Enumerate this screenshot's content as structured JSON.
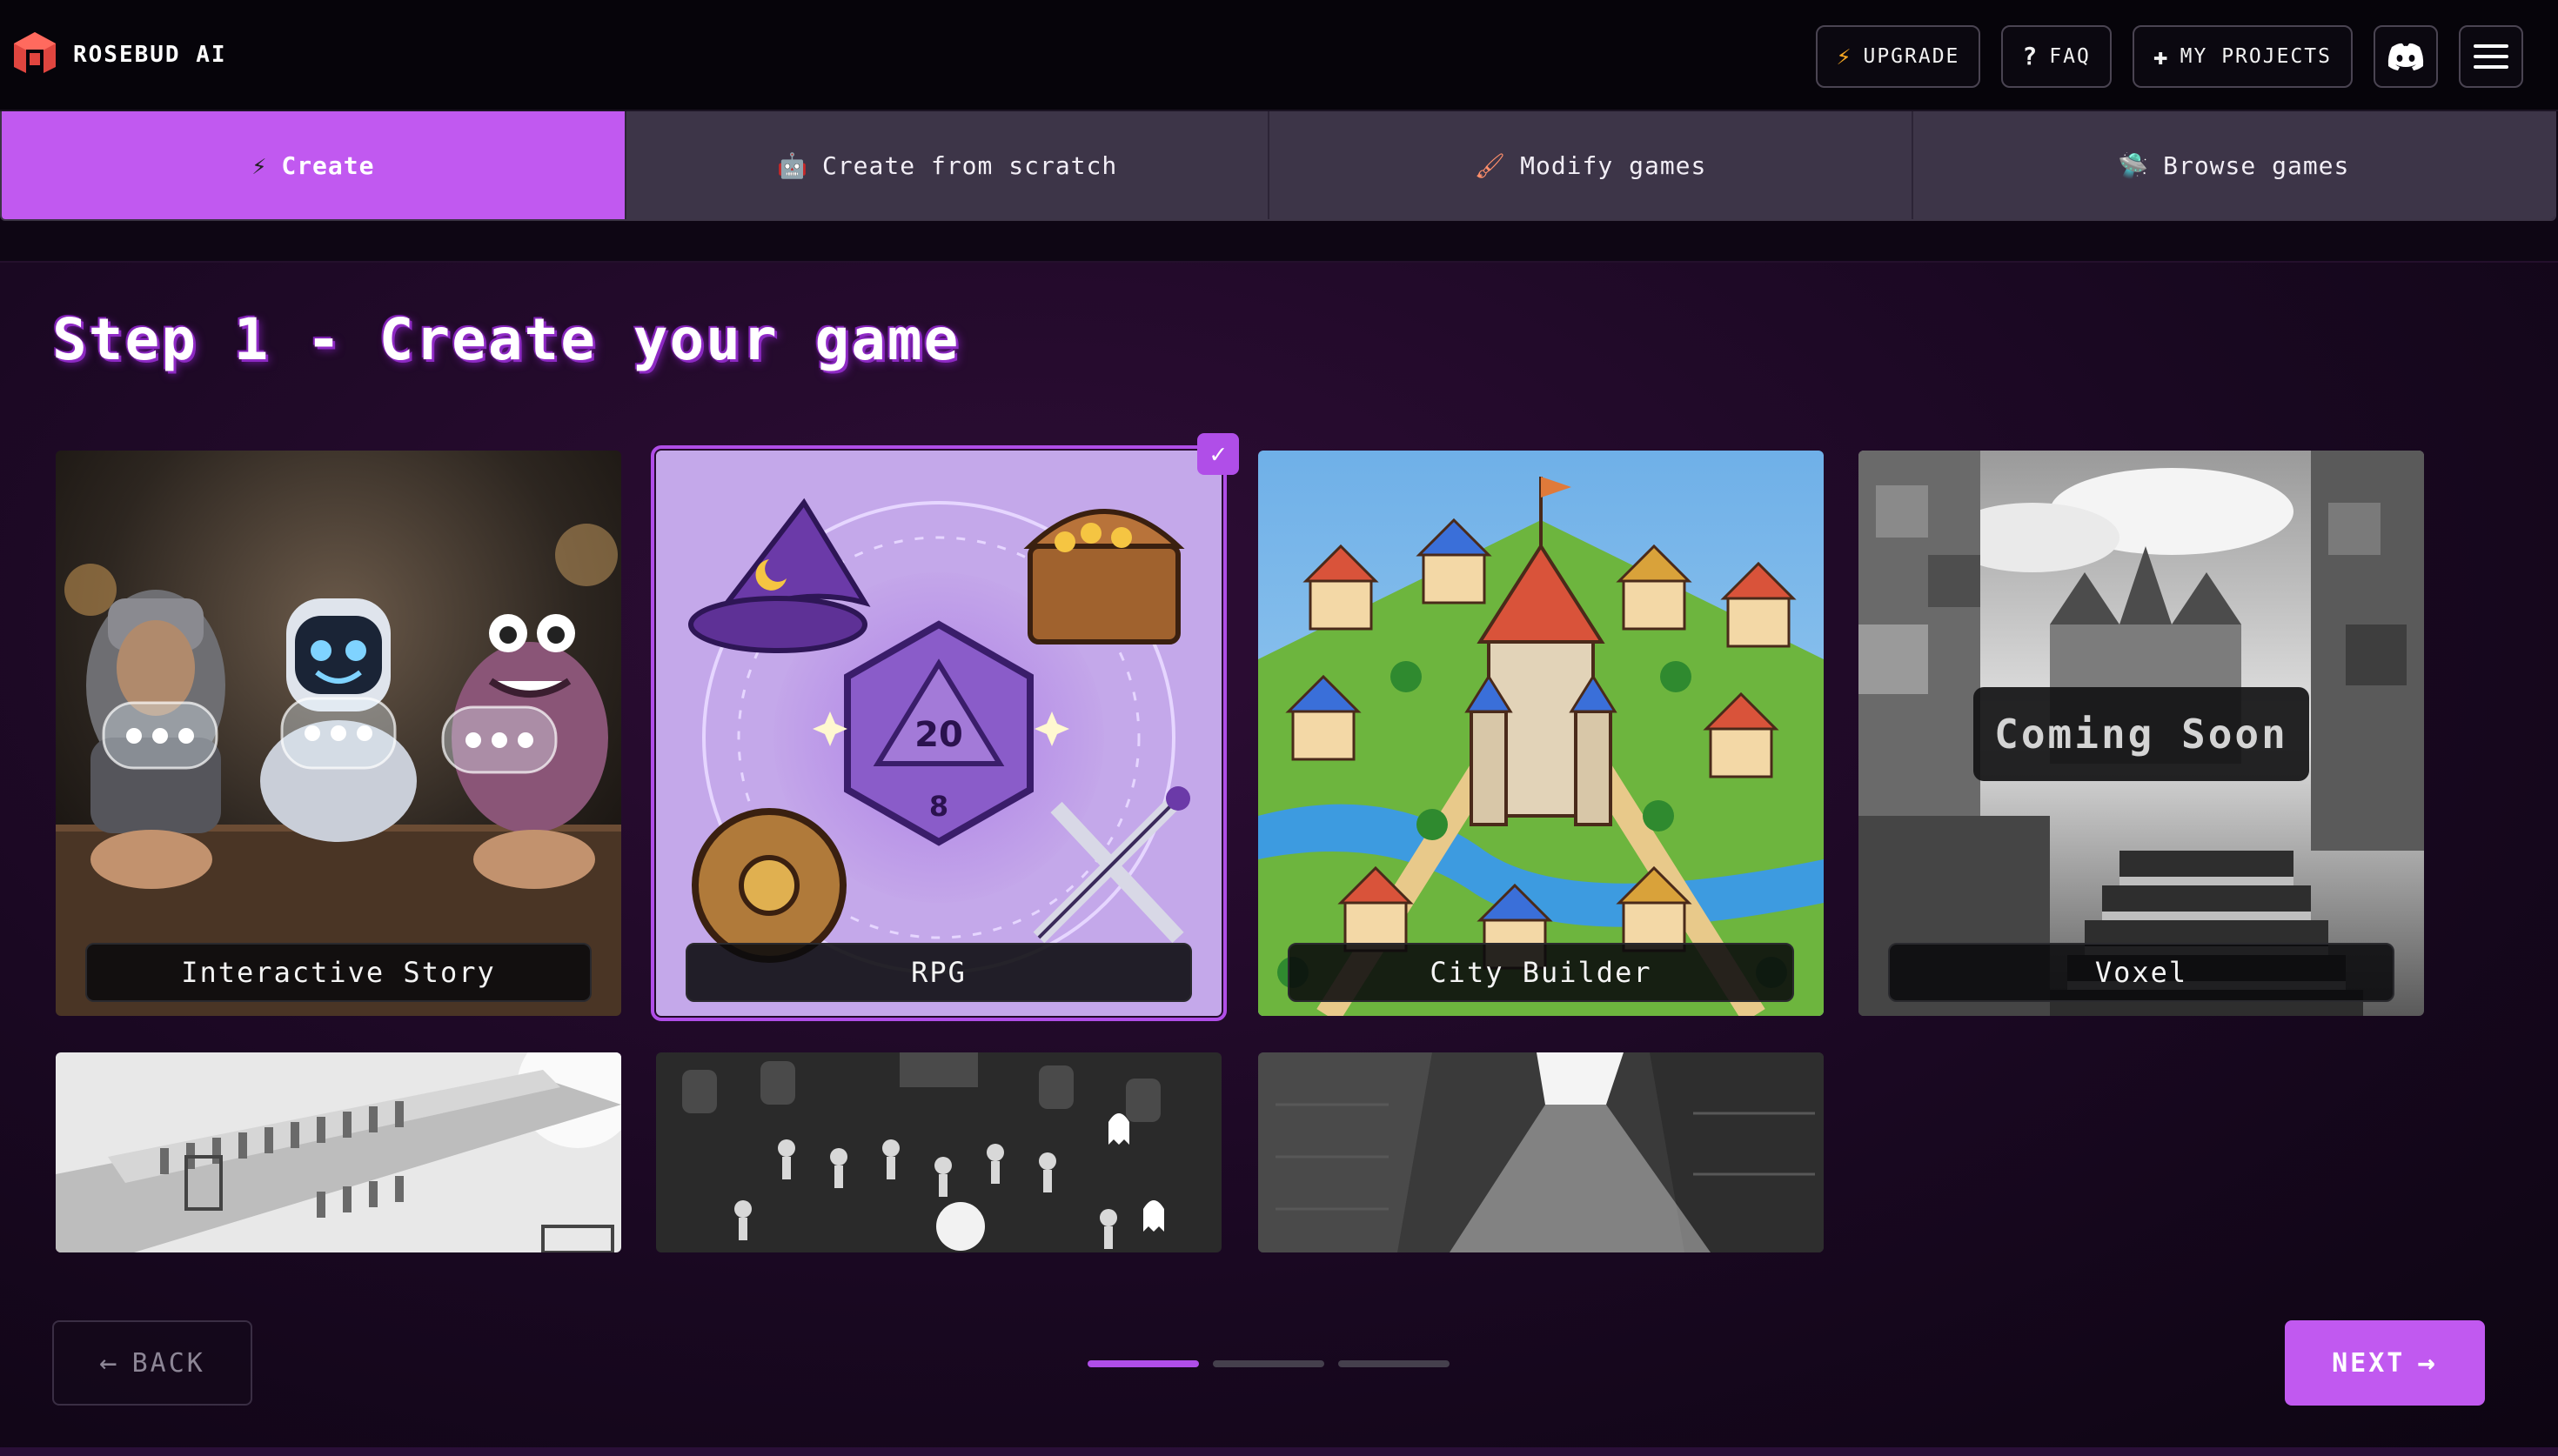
{
  "header": {
    "brand": "ROSEBUD AI",
    "actions": [
      {
        "label": "UPGRADE",
        "icon": "lightning-icon"
      },
      {
        "label": "FAQ",
        "icon": "question-icon"
      },
      {
        "label": "MY PROJECTS",
        "icon": "sparkle-plus-icon"
      }
    ],
    "discord_icon": "discord-icon",
    "menu_icon": "hamburger-menu-icon"
  },
  "tabs": [
    {
      "label": "Create",
      "icon": "lightning-icon",
      "active": true
    },
    {
      "label": "Create from scratch",
      "icon": "robot-icon",
      "active": false
    },
    {
      "label": "Modify games",
      "icon": "paintbrush-icon",
      "active": false
    },
    {
      "label": "Browse games",
      "icon": "ufo-icon",
      "active": false
    }
  ],
  "main": {
    "title": "Step 1 - Create your game",
    "cards": [
      {
        "label": "Interactive Story",
        "selected": false
      },
      {
        "label": "RPG",
        "selected": true
      },
      {
        "label": "City Builder",
        "selected": false
      },
      {
        "label": "Voxel",
        "selected": false,
        "overlay": "Coming Soon"
      }
    ]
  },
  "footer": {
    "back_label": "BACK",
    "next_label": "NEXT",
    "steps": 3,
    "current_step": 1
  },
  "colors": {
    "accent": "#c159f0",
    "tab_inactive": "#3d3548",
    "background": "#1a0822"
  }
}
